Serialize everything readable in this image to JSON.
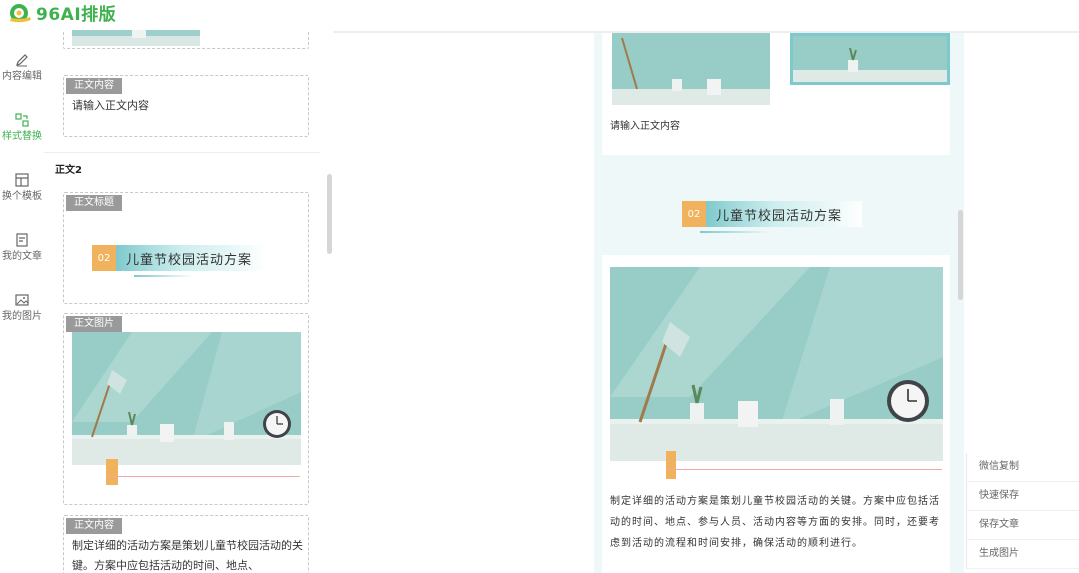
{
  "app": {
    "logo_text": "96AI排版"
  },
  "sidebar": {
    "items": [
      {
        "label": "内容编辑",
        "icon": "pen-icon",
        "active": false
      },
      {
        "label": "样式替换",
        "icon": "style-swap-icon",
        "active": true
      },
      {
        "label": "换个模板",
        "icon": "template-icon",
        "active": false
      },
      {
        "label": "我的文章",
        "icon": "article-icon",
        "active": false
      },
      {
        "label": "我的图片",
        "icon": "image-icon",
        "active": false
      }
    ]
  },
  "editor": {
    "card1": {
      "tag": "正文内容",
      "text": "请输入正文内容"
    },
    "section2_title": "正文2",
    "card2": {
      "tag": "正文标题",
      "num": "02",
      "title": "儿童节校园活动方案"
    },
    "card3": {
      "tag": "正文图片"
    },
    "card4": {
      "tag": "正文内容",
      "text": "制定详细的活动方案是策划儿童节校园活动的关键。方案中应包括活动的时间、地点、"
    }
  },
  "preview": {
    "top_text": "请输入正文内容",
    "num": "02",
    "title": "儿童节校园活动方案",
    "body": "制定详细的活动方案是策划儿童节校园活动的关键。方案中应包括活动的时间、地点、参与人员、活动内容等方面的安排。同时，还要考虑到活动的流程和时间安排，确保活动的顺利进行。"
  },
  "actions": {
    "weixin_copy": "微信复制",
    "quick_save": "快速保存",
    "save_article": "保存文章",
    "gen_image": "生成图片"
  },
  "colors": {
    "brand": "#3fb24f",
    "accent_orange": "#f0b25d",
    "teal": "#7ec9cd",
    "tag_gray": "#9a9a9a"
  }
}
